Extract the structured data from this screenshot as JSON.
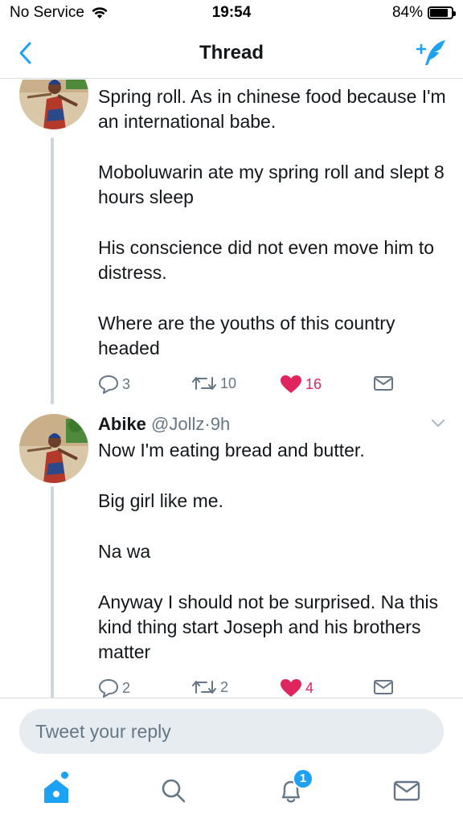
{
  "status_bar": {
    "carrier": "No Service",
    "time": "19:54",
    "battery": "84%",
    "battery_level": 0.84
  },
  "nav": {
    "title": "Thread",
    "back_icon": "chevron-left-icon",
    "compose_icon": "compose-tweet-icon"
  },
  "tweets": [
    {
      "paragraphs": [
        "Spring roll. As in chinese food because I'm an international babe.",
        "Moboluwarin ate my spring roll and slept 8 hours sleep",
        "His conscience did not even move him to distress.",
        "Where are the youths of this country headed"
      ],
      "replies": "3",
      "retweets": "10",
      "likes": "16",
      "liked": true
    },
    {
      "name": "Abike",
      "handle": "@Jollz",
      "separator": "·",
      "time": "9h",
      "paragraphs": [
        "Now I'm eating bread and butter.",
        "Big girl like me.",
        "Na wa",
        "Anyway I should not be surprised. Na this kind thing start Joseph and his brothers matter"
      ],
      "replies": "2",
      "retweets": "2",
      "likes": "4",
      "liked": true
    }
  ],
  "reply": {
    "placeholder": "Tweet your reply"
  },
  "tabbar": {
    "notifications_badge": "1",
    "items": [
      "home-icon",
      "search-icon",
      "notifications-bell-icon",
      "messages-envelope-icon"
    ]
  },
  "colors": {
    "accent": "#1da1f2",
    "like": "#e0245e",
    "secondary_text": "#657786",
    "thread_line": "#ccd6dd"
  }
}
